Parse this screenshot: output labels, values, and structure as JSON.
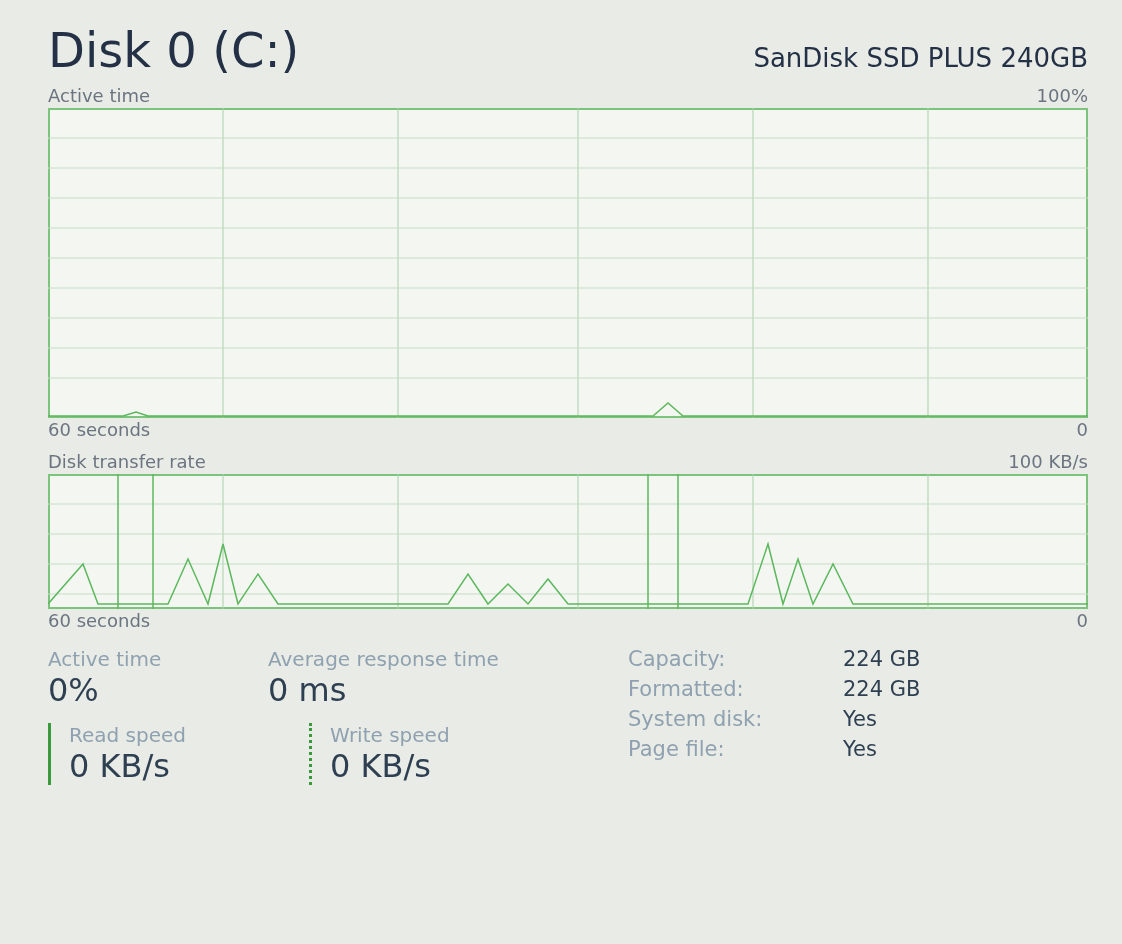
{
  "header": {
    "title": "Disk 0 (C:)",
    "model": "SanDisk SSD PLUS 240GB"
  },
  "active_chart": {
    "label": "Active time",
    "max": "100%",
    "span": "60 seconds",
    "min": "0"
  },
  "transfer_chart": {
    "label": "Disk transfer rate",
    "max": "100 KB/s",
    "span": "60 seconds",
    "min": "0"
  },
  "stats": [
    {
      "label": "Active time",
      "value": "0%"
    },
    {
      "label": "Average response time",
      "value": "0 ms"
    }
  ],
  "speeds": [
    {
      "kind": "solid",
      "label": "Read speed",
      "value": "0 KB/s"
    },
    {
      "kind": "dotted",
      "label": "Write speed",
      "value": "0 KB/s"
    }
  ],
  "properties": [
    {
      "label": "Capacity:",
      "value": "224 GB"
    },
    {
      "label": "Formatted:",
      "value": "224 GB"
    },
    {
      "label": "System disk:",
      "value": "Yes"
    },
    {
      "label": "Page file:",
      "value": "Yes"
    }
  ]
}
